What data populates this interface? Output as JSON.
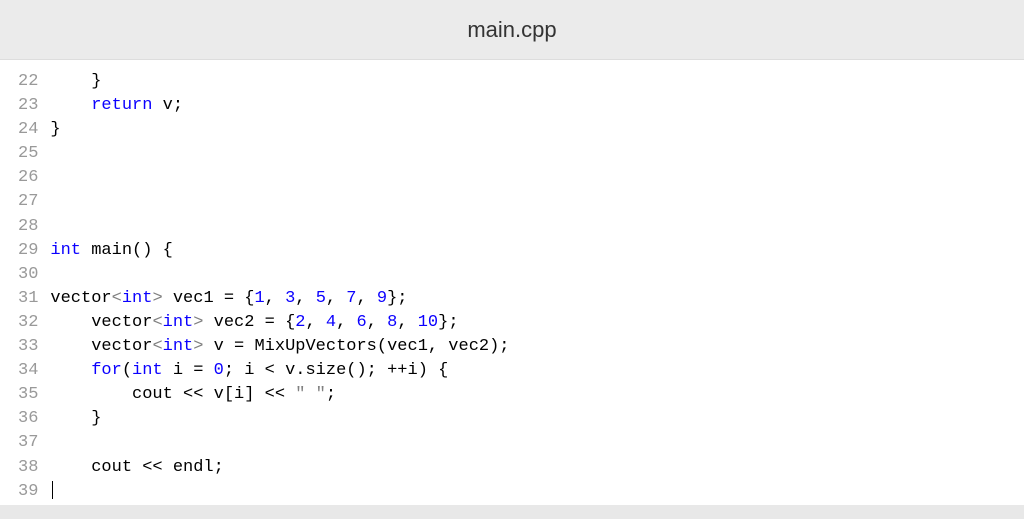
{
  "tab": {
    "filename": "main.cpp"
  },
  "gutter": {
    "start": 22,
    "end": 39
  },
  "code": {
    "lines": [
      {
        "indent": "    ",
        "tokens": [
          {
            "t": "}",
            "c": "brace"
          }
        ]
      },
      {
        "indent": "    ",
        "tokens": [
          {
            "t": "return",
            "c": "kw"
          },
          {
            "t": " v;",
            "c": "id"
          }
        ]
      },
      {
        "indent": "",
        "tokens": [
          {
            "t": "}",
            "c": "brace"
          }
        ]
      },
      {
        "indent": "",
        "tokens": []
      },
      {
        "indent": "",
        "tokens": []
      },
      {
        "indent": "",
        "tokens": []
      },
      {
        "indent": "",
        "tokens": []
      },
      {
        "indent": "",
        "tokens": [
          {
            "t": "int",
            "c": "kw"
          },
          {
            "t": " main() {",
            "c": "id"
          }
        ]
      },
      {
        "indent": "",
        "tokens": []
      },
      {
        "indent": "",
        "tokens": [
          {
            "t": "vector",
            "c": "id"
          },
          {
            "t": "<",
            "c": "angle"
          },
          {
            "t": "int",
            "c": "kw"
          },
          {
            "t": ">",
            "c": "angle"
          },
          {
            "t": " vec1 = {",
            "c": "id"
          },
          {
            "t": "1",
            "c": "num"
          },
          {
            "t": ", ",
            "c": "id"
          },
          {
            "t": "3",
            "c": "num"
          },
          {
            "t": ", ",
            "c": "id"
          },
          {
            "t": "5",
            "c": "num"
          },
          {
            "t": ", ",
            "c": "id"
          },
          {
            "t": "7",
            "c": "num"
          },
          {
            "t": ", ",
            "c": "id"
          },
          {
            "t": "9",
            "c": "num"
          },
          {
            "t": "};",
            "c": "id"
          }
        ]
      },
      {
        "indent": "    ",
        "tokens": [
          {
            "t": "vector",
            "c": "id"
          },
          {
            "t": "<",
            "c": "angle"
          },
          {
            "t": "int",
            "c": "kw"
          },
          {
            "t": ">",
            "c": "angle"
          },
          {
            "t": " vec2 = {",
            "c": "id"
          },
          {
            "t": "2",
            "c": "num"
          },
          {
            "t": ", ",
            "c": "id"
          },
          {
            "t": "4",
            "c": "num"
          },
          {
            "t": ", ",
            "c": "id"
          },
          {
            "t": "6",
            "c": "num"
          },
          {
            "t": ", ",
            "c": "id"
          },
          {
            "t": "8",
            "c": "num"
          },
          {
            "t": ", ",
            "c": "id"
          },
          {
            "t": "10",
            "c": "num"
          },
          {
            "t": "};",
            "c": "id"
          }
        ]
      },
      {
        "indent": "    ",
        "tokens": [
          {
            "t": "vector",
            "c": "id"
          },
          {
            "t": "<",
            "c": "angle"
          },
          {
            "t": "int",
            "c": "kw"
          },
          {
            "t": ">",
            "c": "angle"
          },
          {
            "t": " v = MixUpVectors(vec1, vec2);",
            "c": "id"
          }
        ]
      },
      {
        "indent": "    ",
        "tokens": [
          {
            "t": "for",
            "c": "kw"
          },
          {
            "t": "(",
            "c": "id"
          },
          {
            "t": "int",
            "c": "kw"
          },
          {
            "t": " i = ",
            "c": "id"
          },
          {
            "t": "0",
            "c": "num"
          },
          {
            "t": "; i < v.size(); ++i) {",
            "c": "id"
          }
        ]
      },
      {
        "indent": "        ",
        "tokens": [
          {
            "t": "cout << v[i] << ",
            "c": "id"
          },
          {
            "t": "\" \"",
            "c": "str"
          },
          {
            "t": ";",
            "c": "id"
          }
        ]
      },
      {
        "indent": "    ",
        "tokens": [
          {
            "t": "}",
            "c": "brace"
          }
        ]
      },
      {
        "indent": "",
        "tokens": []
      },
      {
        "indent": "    ",
        "tokens": [
          {
            "t": "cout << endl;",
            "c": "id"
          }
        ]
      },
      {
        "indent": "",
        "tokens": [],
        "cursor": true
      }
    ]
  }
}
